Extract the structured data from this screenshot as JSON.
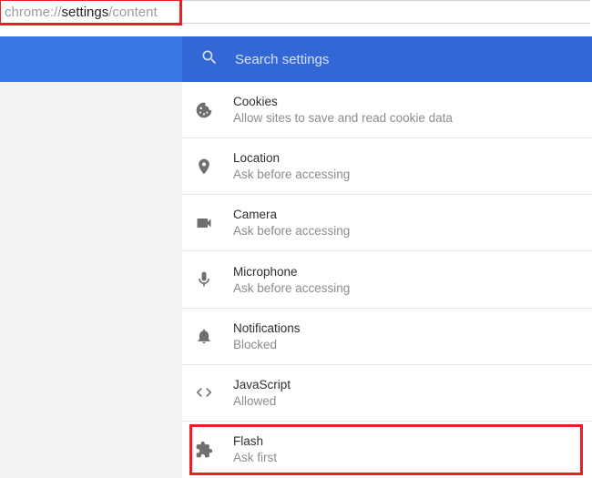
{
  "url": {
    "pre": "chrome://",
    "mid": "settings",
    "post": "/content"
  },
  "search": {
    "placeholder": "Search settings"
  },
  "rows": {
    "cookies": {
      "title": "Cookies",
      "sub": "Allow sites to save and read cookie data"
    },
    "location": {
      "title": "Location",
      "sub": "Ask before accessing"
    },
    "camera": {
      "title": "Camera",
      "sub": "Ask before accessing"
    },
    "microphone": {
      "title": "Microphone",
      "sub": "Ask before accessing"
    },
    "notifications": {
      "title": "Notifications",
      "sub": "Blocked"
    },
    "javascript": {
      "title": "JavaScript",
      "sub": "Allowed"
    },
    "flash": {
      "title": "Flash",
      "sub": "Ask first"
    }
  }
}
